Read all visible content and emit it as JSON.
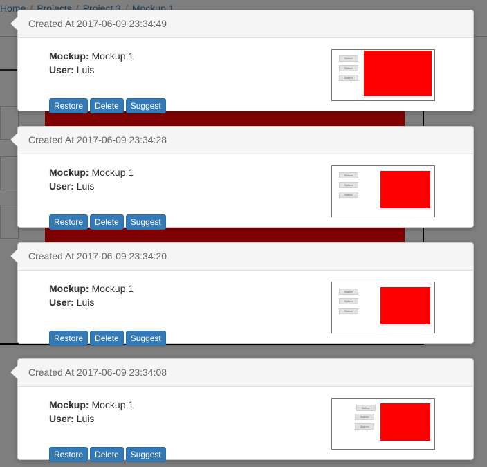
{
  "breadcrumb": [
    {
      "label": "Home"
    },
    {
      "label": "Projects"
    },
    {
      "label": "Project 3"
    },
    {
      "label": "Mockup 1"
    }
  ],
  "labels": {
    "created_prefix": "Created At",
    "mockup_label": "Mockup:",
    "user_label": "User:"
  },
  "actions": {
    "restore": "Restore",
    "delete": "Delete",
    "suggest": "Suggest"
  },
  "versions": [
    {
      "created_at": "2017-06-09 23:34:49",
      "mockup": "Mockup 1",
      "user": "Luis",
      "thumb_buttons": [
        "Button",
        "Button",
        "Button"
      ]
    },
    {
      "created_at": "2017-06-09 23:34:28",
      "mockup": "Mockup 1",
      "user": "Luis",
      "thumb_buttons": [
        "Button",
        "Button",
        "Button"
      ]
    },
    {
      "created_at": "2017-06-09 23:34:20",
      "mockup": "Mockup 1",
      "user": "Luis",
      "thumb_buttons": [
        "Button",
        "Button",
        "Button"
      ]
    },
    {
      "created_at": "2017-06-09 23:34:08",
      "mockup": "Mockup 1",
      "user": "Luis",
      "thumb_buttons": [
        "Button",
        "Button",
        "Button"
      ]
    }
  ],
  "colors": {
    "primary_button": "#337ab7",
    "canvas_red": "#ff0000",
    "overlay": "rgba(0,0,0,0.5)"
  }
}
